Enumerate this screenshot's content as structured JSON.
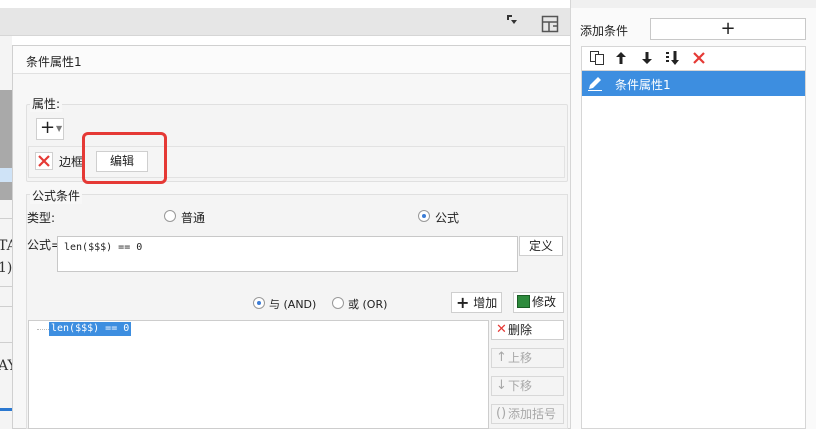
{
  "background": {
    "left_texts": [
      "TA",
      "1)",
      "AY"
    ]
  },
  "right_panel": {
    "add_condition_label": "添加条件",
    "add_button": "+",
    "items": [
      {
        "label": "条件属性1",
        "selected": true
      }
    ]
  },
  "dialog": {
    "title": "条件属性1",
    "properties": {
      "section_label": "属性:",
      "add_button": "+",
      "border_label": "边框",
      "edit_button": "编辑"
    },
    "formula_condition": {
      "section_label": "公式条件",
      "type_label": "类型:",
      "type_options": [
        {
          "label": "普通",
          "selected": false
        },
        {
          "label": "公式",
          "selected": true
        }
      ],
      "formula_label": "公式=",
      "formula_value": "len($$$) == 0",
      "define_button": "定义",
      "logic_options": [
        {
          "label": "与 (AND)",
          "selected": true
        },
        {
          "label": "或 (OR)",
          "selected": false
        }
      ],
      "add_button": "增加",
      "modify_button": "修改",
      "condition_items": [
        "len($$$) == 0"
      ],
      "delete_button": "删除",
      "move_up_button": "上移",
      "move_down_button": "下移",
      "add_bracket_button": "添加括号"
    }
  },
  "colors": {
    "selection": "#3d8ee0",
    "highlight_box": "#e53935",
    "delete_red": "#e53935",
    "modify_green": "#2e8b3d"
  }
}
